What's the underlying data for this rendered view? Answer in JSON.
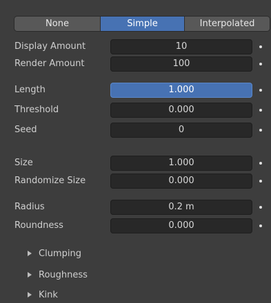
{
  "mode_selector": {
    "options": [
      "None",
      "Simple",
      "Interpolated"
    ],
    "selected": "Simple"
  },
  "rows": {
    "display_amount": {
      "label": "Display Amount",
      "value": "10"
    },
    "render_amount": {
      "label": "Render Amount",
      "value": "100"
    },
    "length": {
      "label": "Length",
      "value": "1.000"
    },
    "threshold": {
      "label": "Threshold",
      "value": "0.000"
    },
    "seed": {
      "label": "Seed",
      "value": "0"
    },
    "size": {
      "label": "Size",
      "value": "1.000"
    },
    "randomize_size": {
      "label": "Randomize Size",
      "value": "0.000"
    },
    "radius": {
      "label": "Radius",
      "value": "0.2 m"
    },
    "roundness": {
      "label": "Roundness",
      "value": "0.000"
    }
  },
  "subpanels": [
    "Clumping",
    "Roughness",
    "Kink"
  ],
  "colors": {
    "background": "#3d3d3d",
    "field_background": "#282828",
    "active_accent": "#4772b3"
  }
}
